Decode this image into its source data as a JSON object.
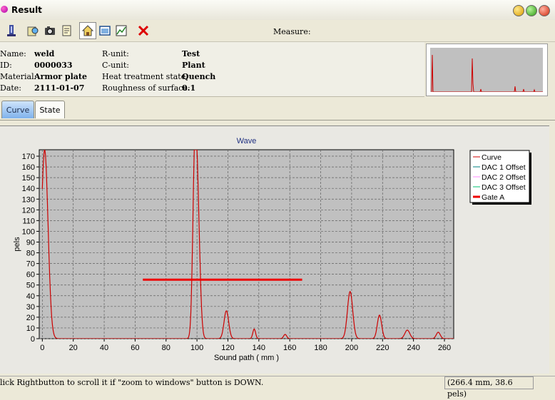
{
  "window": {
    "title": "Result"
  },
  "toolbar": {
    "measure_label": "Measure:",
    "icons": [
      "probe-icon",
      "open-icon",
      "camera-icon",
      "report-icon",
      "home-icon",
      "window-icon",
      "chart-icon",
      "delete-icon"
    ]
  },
  "info": {
    "rows": [
      {
        "label": "Name:",
        "value": "weld",
        "label2": "R-unit:",
        "value2": "Test"
      },
      {
        "label": "ID:",
        "value": "0000033",
        "label2": "C-unit:",
        "value2": "Plant"
      },
      {
        "label": "Material:",
        "value": "Armor plate",
        "label2": "Heat treatment state:",
        "value2": "Quench"
      },
      {
        "label": "Date:",
        "value": "2111-01-07",
        "label2": "Roughness of surface:",
        "value2": "0.1"
      }
    ]
  },
  "tabs": [
    {
      "label": "Curve",
      "active": true
    },
    {
      "label": "State",
      "active": false
    }
  ],
  "status": {
    "hint": "lick Rightbutton to scroll it if  \"zoom to windows\" button is DOWN.",
    "coords": "(266.4 mm, 38.6 pels)"
  },
  "chart_data": {
    "type": "line",
    "title": "Wave",
    "xlabel": "Sound path ( mm )",
    "ylabel": "pels",
    "xlim": [
      -2,
      266
    ],
    "ylim": [
      0,
      176
    ],
    "xticks": [
      0,
      20,
      40,
      60,
      80,
      100,
      120,
      140,
      160,
      180,
      200,
      220,
      240,
      260
    ],
    "yticks": [
      0,
      10,
      20,
      30,
      40,
      50,
      60,
      70,
      80,
      90,
      100,
      110,
      120,
      130,
      140,
      150,
      160,
      170
    ],
    "grid": true,
    "legend_position": "right",
    "legend": [
      {
        "name": "Curve",
        "color": "#cc0000",
        "thick": false
      },
      {
        "name": "DAC 1 Offset",
        "color": "#008080",
        "thick": false
      },
      {
        "name": "DAC 2 Offset",
        "color": "#ff88ff",
        "thick": false
      },
      {
        "name": "DAC 3 Offset",
        "color": "#00c070",
        "thick": false
      },
      {
        "name": "Gate A",
        "color": "#ee0000",
        "thick": true
      }
    ],
    "peaks": [
      {
        "x": 1.5,
        "y": 176,
        "width": 2.2
      },
      {
        "x": 98.5,
        "y": 144,
        "width": 1.3
      },
      {
        "x": 100.5,
        "y": 110,
        "width": 1.5
      },
      {
        "x": 119,
        "y": 26,
        "width": 1.5
      },
      {
        "x": 137,
        "y": 9,
        "width": 0.9
      },
      {
        "x": 157,
        "y": 4,
        "width": 1.0
      },
      {
        "x": 199,
        "y": 44,
        "width": 1.7
      },
      {
        "x": 218,
        "y": 22,
        "width": 1.4
      },
      {
        "x": 236,
        "y": 8,
        "width": 1.6
      },
      {
        "x": 256,
        "y": 6,
        "width": 1.3
      }
    ],
    "gate_a": {
      "x_start": 65,
      "x_end": 168,
      "y": 55
    }
  }
}
